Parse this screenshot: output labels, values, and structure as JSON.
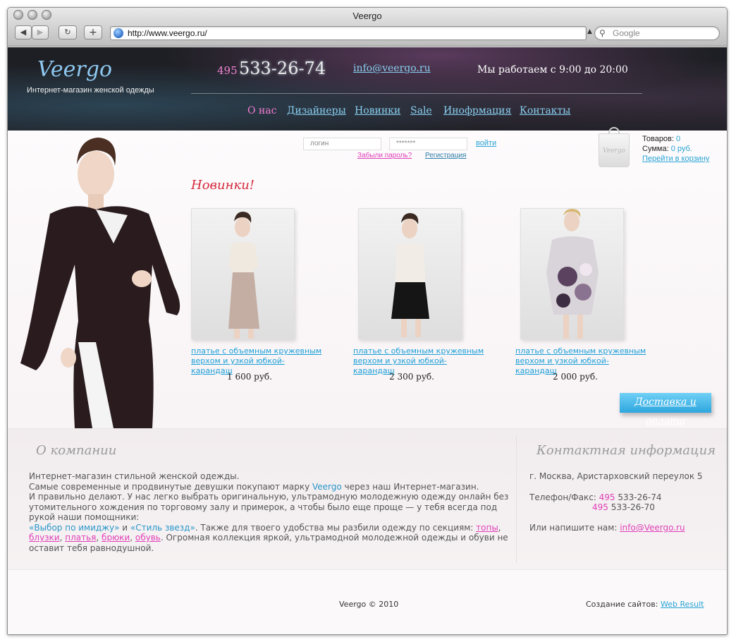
{
  "browser": {
    "title": "Veergo",
    "url": "http://www.veergo.ru/",
    "search_placeholder": "Google"
  },
  "header": {
    "logo": "Veergo",
    "tagline": "Интернет-магазин женской одежды",
    "phone_code": "495",
    "phone_number": "533-26-74",
    "email": "info@veergo.ru",
    "hours": "Мы работаем с 9:00 до 20:00"
  },
  "nav": [
    {
      "label": "О нас"
    },
    {
      "label": "Дизайнеры"
    },
    {
      "label": "Новинки"
    },
    {
      "label": "Sale"
    },
    {
      "label": "Инофрмация"
    },
    {
      "label": "Контакты"
    }
  ],
  "login": {
    "login_placeholder": "логин",
    "password_placeholder": "*******",
    "submit": "войти",
    "forgot": "Забыли пароль?",
    "register": "Регистрация"
  },
  "cart": {
    "bag_label": "Veergo",
    "items_label": "Товаров:",
    "items_value": "0",
    "sum_label": "Сумма:",
    "sum_value": "0 руб.",
    "go_to_cart": "Перейти в корзину"
  },
  "new_arrivals": {
    "title": "Новинки!",
    "products": [
      {
        "name_line1": "платье с объемным кружевным",
        "name_line2": "верхом и узкой юбкой-карандаш",
        "price": "1 600 руб."
      },
      {
        "name_line1": "платье с объемным кружевным",
        "name_line2": "верхом и узкой юбкой-карандаш",
        "price": "2 300 руб."
      },
      {
        "name_line1": "платье с объемным кружевным",
        "name_line2": "верхом и узкой юбкой-карандаш",
        "price": "2 000 руб."
      }
    ],
    "delivery_button": "Доставка и оплата"
  },
  "about": {
    "title": "О компании",
    "line1": "Интернет-магазин стильной женской одежды.",
    "line2_a": "Самые современные и продвинутые девушки покупают марку ",
    "line2_brand": "Veergo",
    "line2_b": " через наш Интернет-магазин.",
    "line3": "И правильно делают. У нас легко выбрать оригинальную, ультрамодную молодежную одежду онлайн без утомительного хождения по торговому залу и примерок, а чтобы было еще проще — у тебя всегда под рукой наши помощники:",
    "link_image": "«Выбор по имиджу»",
    "and": " и ",
    "link_stars": "«Стиль звезд»",
    "line4_b": ". Также для твоего удобства мы разбили одежду  по секциям: ",
    "sec_tops": "топы",
    "sec_blouses": "блузки",
    "sec_dresses": "платья",
    "sec_trousers": "брюки",
    "sec_shoes": "обувь",
    "comma": ", ",
    "tail": ". Огромная коллекция яркой, ультрамодной молодежной одежды и обуви не оставит тебя равнодушной."
  },
  "contacts": {
    "title": "Контактная информация",
    "address": "г. Москва, Аристарховский переулок 5",
    "phone_label": "Телефон/Факс:",
    "code": "495",
    "phone1": "533-26-74",
    "phone2": "533-26-70",
    "write_label": "Или напишите нам:",
    "email": "info@Veergo.ru"
  },
  "footer": {
    "copyright": "Veergo © 2010",
    "credits_label": "Создание сайтов:",
    "credits_link": "Web Result"
  },
  "colors": {
    "accent_blue": "#29a4d6",
    "accent_pink": "#e040b8",
    "title_red": "#d42a3c",
    "header_dark": "#1e1f24"
  }
}
